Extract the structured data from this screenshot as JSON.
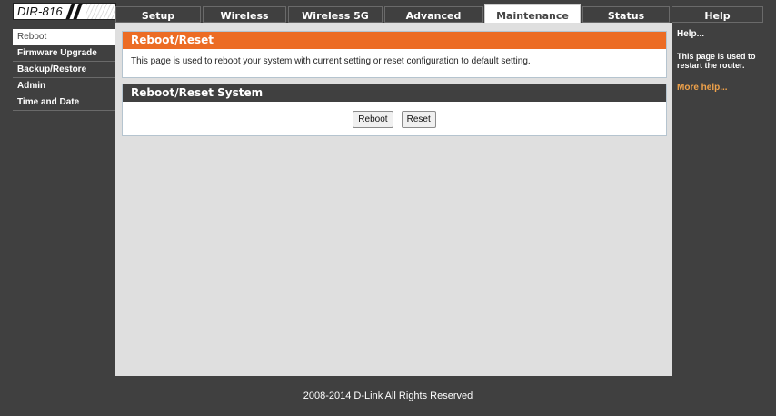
{
  "logo": {
    "text": "DIR-816"
  },
  "tabs": [
    {
      "label": "Setup",
      "active": false
    },
    {
      "label": "Wireless",
      "active": false
    },
    {
      "label": "Wireless 5G",
      "active": false
    },
    {
      "label": "Advanced",
      "active": false
    },
    {
      "label": "Maintenance",
      "active": true
    },
    {
      "label": "Status",
      "active": false
    },
    {
      "label": "Help",
      "active": false
    }
  ],
  "sidebar": {
    "items": [
      {
        "label": "Reboot",
        "active": true
      },
      {
        "label": "Firmware Upgrade",
        "active": false
      },
      {
        "label": "Backup/Restore",
        "active": false
      },
      {
        "label": "Admin",
        "active": false
      },
      {
        "label": "Time and Date",
        "active": false
      }
    ]
  },
  "main": {
    "section1": {
      "title": "Reboot/Reset",
      "description": "This page is used to reboot your system with current setting or reset configuration to default setting."
    },
    "section2": {
      "title": "Reboot/Reset System",
      "reboot_label": "Reboot",
      "reset_label": "Reset"
    }
  },
  "help": {
    "title": "Help...",
    "text": "This page is used to restart the router.",
    "more_link": "More help..."
  },
  "footer": {
    "text": "2008-2014 D-Link All Rights Reserved"
  },
  "colors": {
    "accent": "#ec6c24",
    "dark": "#404040",
    "link": "#f0a24a"
  }
}
